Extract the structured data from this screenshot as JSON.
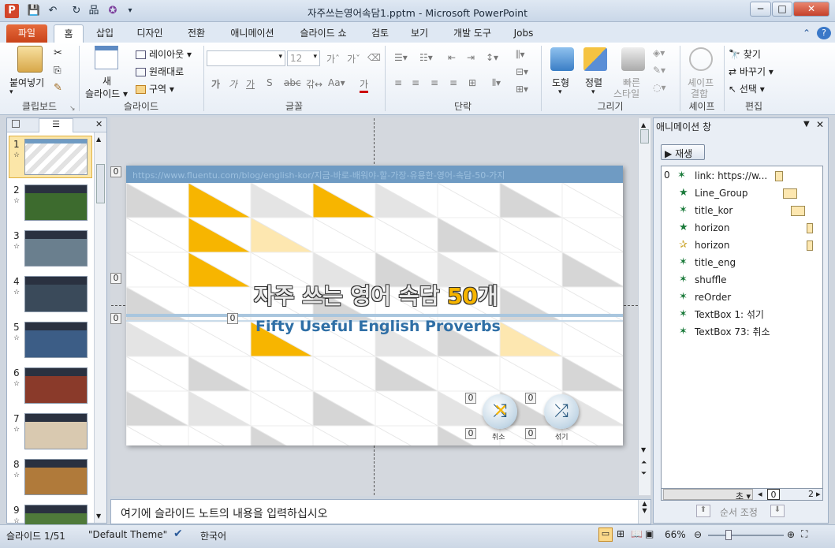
{
  "window": {
    "title": "자주쓰는영어속담1.pptm  -  Microsoft PowerPoint",
    "controls": [
      "─",
      "□",
      "✕"
    ]
  },
  "tabs": [
    "파일",
    "홈",
    "삽입",
    "디자인",
    "전환",
    "애니메이션",
    "슬라이드 쇼",
    "검토",
    "보기",
    "개발 도구",
    "Jobs"
  ],
  "ribbon": {
    "clipboard": {
      "paste": "붙여넣기",
      "label": "클립보드"
    },
    "slides": {
      "new_slide": "새\n슬라이드",
      "new_slide_line1": "새",
      "new_slide_line2": "슬라이드 ▾",
      "layout": "레이아웃 ▾",
      "reset": "원래대로",
      "section": "구역 ▾",
      "label": "슬라이드"
    },
    "font": {
      "size": "12",
      "label": "글꼴"
    },
    "paragraph": {
      "label": "단락"
    },
    "drawing": {
      "shapes": "도형",
      "arrange": "정렬",
      "quick_styles_1": "빠른",
      "quick_styles_2": "스타일",
      "label": "그리기"
    },
    "shape_merge": {
      "line1": "셰이프",
      "line2": "결합",
      "label": "셰이프"
    },
    "editing": {
      "find": "찾기",
      "replace": "바꾸기 ▾",
      "select": "선택 ▾",
      "label": "편집"
    }
  },
  "slide_panel": {
    "numbers": [
      "1",
      "2",
      "3",
      "4",
      "5",
      "6",
      "7",
      "8",
      "9"
    ]
  },
  "slide": {
    "url": "https://www.fluentu.com/blog/english-kor/지금-바로-배워야-할-가장-유용한-영어-속담-50-가지",
    "title_kor_main": "자주 쓰는 영어 속담 ",
    "title_kor_num": "50",
    "title_kor_suffix": "개",
    "title_eng": "Fifty Useful English Proverbs",
    "btn_cancel": "취소",
    "btn_shuffle": "섞기",
    "tags": [
      "0",
      "0",
      "0",
      "0",
      "0",
      "0",
      "0",
      "0"
    ]
  },
  "notes": {
    "placeholder": "여기에 슬라이드 노트의 내용을 입력하십시오"
  },
  "anim_pane": {
    "title": "애니메이션 창",
    "play": "재생",
    "first_index": "0",
    "items": [
      "link: https://w...",
      "Line_Group",
      "title_kor",
      "horizon",
      "horizon",
      "title_eng",
      "shuffle",
      "reOrder",
      "TextBox 1: 섞기",
      "TextBox 73: 취소"
    ],
    "seconds_label": "초 ▾",
    "timeline_start": "0",
    "timeline_end": "2",
    "reorder_label": "순서 조정"
  },
  "status": {
    "slide": "슬라이드 1/51",
    "theme": "\"Default Theme\"",
    "language": "한국어",
    "zoom": "66%"
  },
  "colors": {
    "orange": "#f7b500",
    "light_orange": "#fde7b0",
    "blue": "#2f6fa6",
    "gray": "#d6d6d6"
  }
}
